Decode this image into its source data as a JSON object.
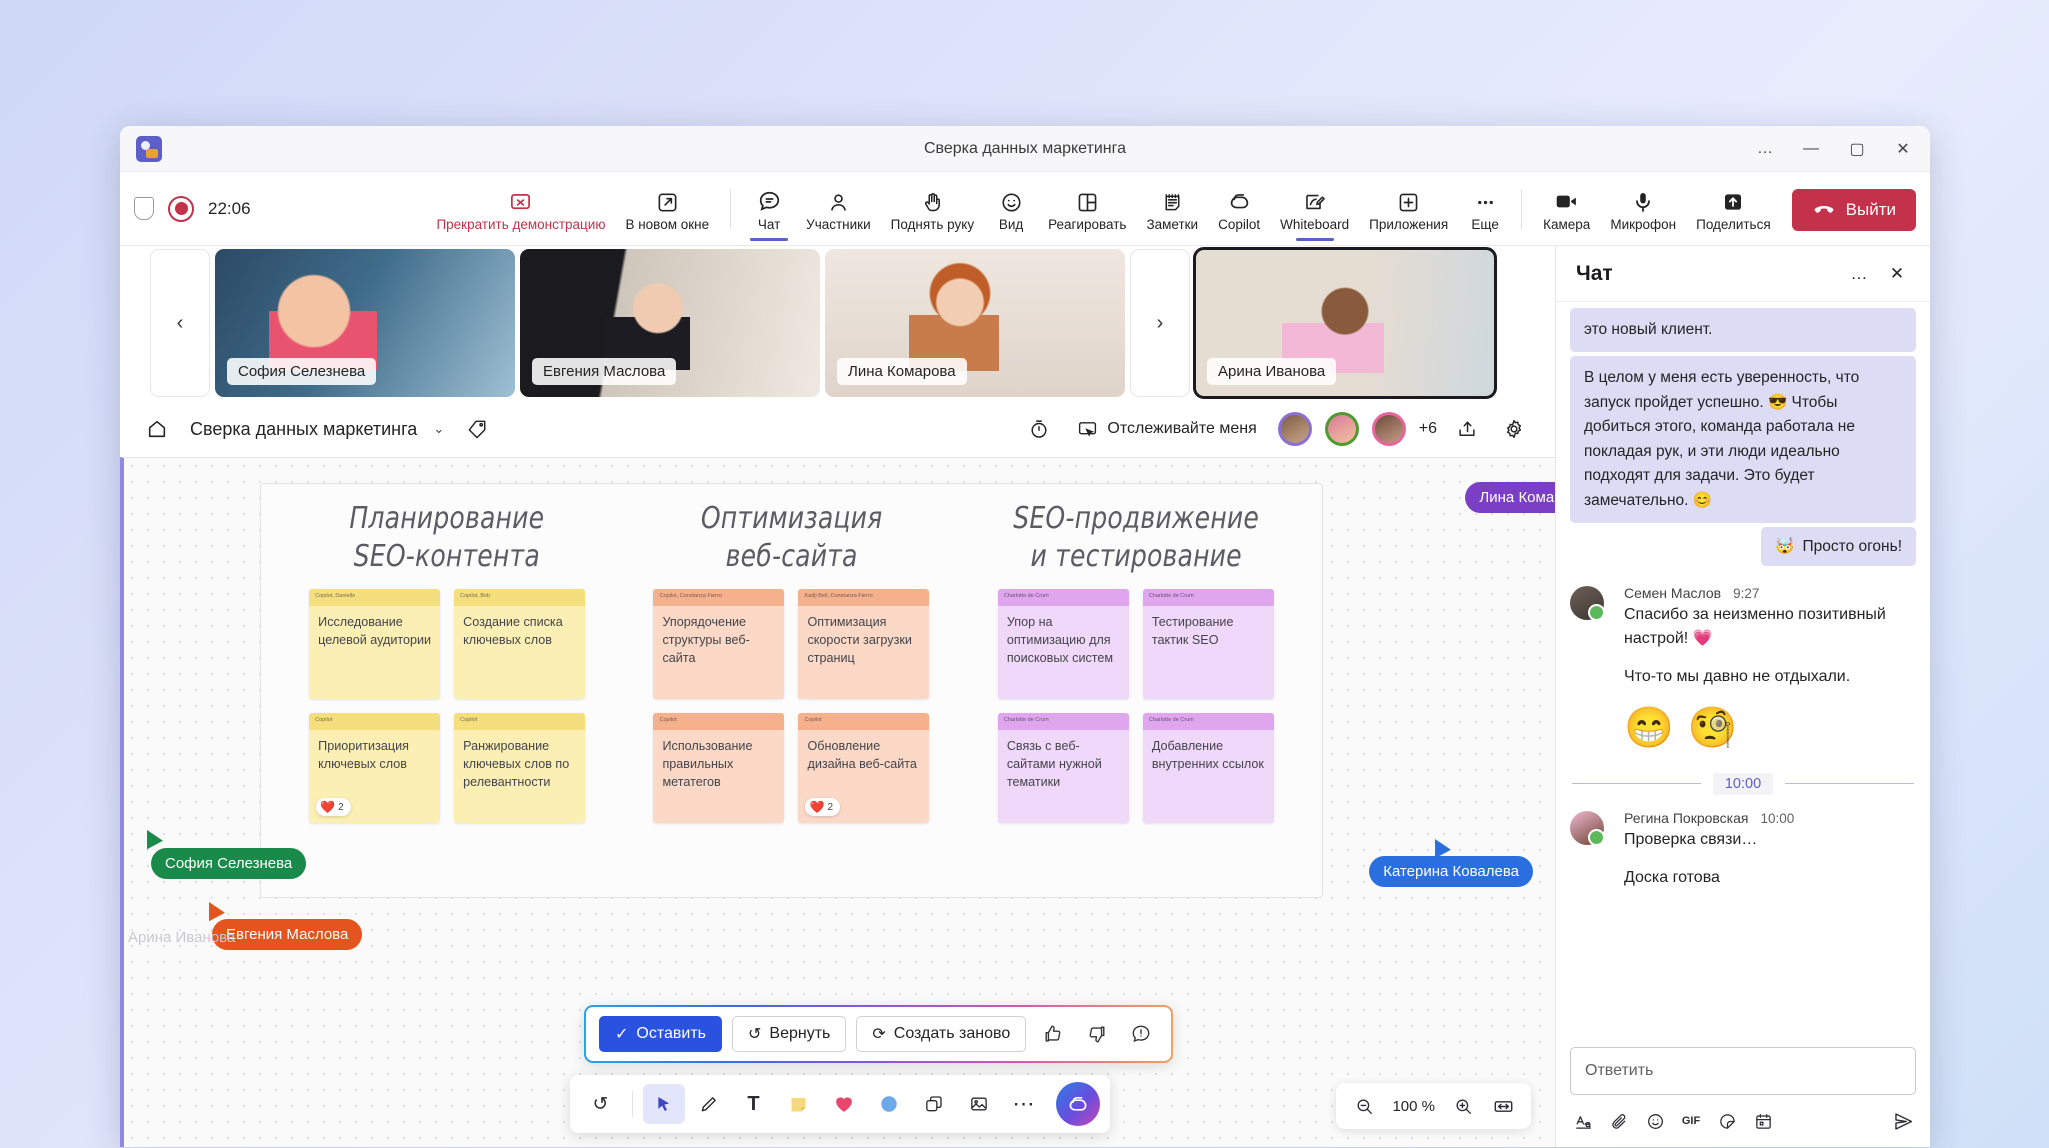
{
  "window": {
    "title": "Сверка данных маркетинга",
    "controls": {
      "more": "…",
      "minimize": "—",
      "maximize": "▢",
      "close": "✕"
    }
  },
  "meeting_bar": {
    "time": "22:06",
    "items": [
      {
        "label": "Прекратить демонстрацию",
        "icon": "stop-share-icon"
      },
      {
        "label": "В новом окне",
        "icon": "popout-icon"
      },
      {
        "label": "Чат",
        "icon": "chat-icon"
      },
      {
        "label": "Участники",
        "icon": "people-icon"
      },
      {
        "label": "Поднять руку",
        "icon": "raise-hand-icon"
      },
      {
        "label": "Вид",
        "icon": "view-icon"
      },
      {
        "label": "Реагировать",
        "icon": "react-icon"
      },
      {
        "label": "Заметки",
        "icon": "notes-icon"
      },
      {
        "label": "Copilot",
        "icon": "copilot-icon"
      },
      {
        "label": "Whiteboard",
        "icon": "whiteboard-icon"
      },
      {
        "label": "Приложения",
        "icon": "apps-icon"
      },
      {
        "label": "Еще",
        "icon": "more-icon"
      },
      {
        "label": "Камера",
        "icon": "camera-icon"
      },
      {
        "label": "Микрофон",
        "icon": "microphone-icon"
      },
      {
        "label": "Поделиться",
        "icon": "share-icon"
      }
    ],
    "leave_label": "Выйти"
  },
  "video_strip": {
    "prev": "‹",
    "next": "›",
    "participants": [
      {
        "name": "София Селезнева",
        "active": false
      },
      {
        "name": "Евгения Маслова",
        "active": false
      },
      {
        "name": "Лина Комарова",
        "active": false
      },
      {
        "name": "Арина Иванова",
        "active": true
      }
    ]
  },
  "whiteboard_header": {
    "title": "Сверка данных маркетинга",
    "chevron": "⌄",
    "follow_label": "Отслеживайте меня",
    "overflow_count": "+6"
  },
  "board": {
    "columns": [
      {
        "title_line1": "Планирование",
        "title_line2": "SEO-контента",
        "color": "y",
        "notes": [
          {
            "author": "Copilot, Danielle",
            "text": "Исследование целевой аудитории",
            "reaction": null
          },
          {
            "author": "Copilot, Bob",
            "text": "Создание списка ключевых слов",
            "reaction": null
          },
          {
            "author": "Copilot",
            "text": "Приоритизация ключевых слов",
            "reaction": {
              "emoji": "❤️",
              "count": "2"
            }
          },
          {
            "author": "Copilot",
            "text": "Ранжирование ключевых слов по релевантности",
            "reaction": null
          }
        ]
      },
      {
        "title_line1": "Оптимизация",
        "title_line2": "веб-сайта",
        "color": "o",
        "notes": [
          {
            "author": "Copilot, Constanza Fierro",
            "text": "Упорядочение структуры веб-сайта",
            "reaction": null
          },
          {
            "author": "Kadji Bell, Constanza Fierro",
            "text": "Оптимизация скорости загрузки страниц",
            "reaction": null
          },
          {
            "author": "Copilot",
            "text": "Использование правильных метатегов",
            "reaction": null
          },
          {
            "author": "Copilot",
            "text": "Обновление дизайна веб-сайта",
            "reaction": {
              "emoji": "❤️",
              "count": "2"
            }
          }
        ]
      },
      {
        "title_line1": "SEO-продвижение",
        "title_line2": "и тестирование",
        "color": "p",
        "notes": [
          {
            "author": "Charlotte de Crum",
            "text": "Упор на оптимизацию для поисковых систем",
            "reaction": null
          },
          {
            "author": "Charlotte de Crum",
            "text": "Тестирование тактик SEO",
            "reaction": null
          },
          {
            "author": "Charlotte de Crum",
            "text": "Связь с веб-сайтами нужной тематики",
            "reaction": null
          },
          {
            "author": "Charlotte de Crum",
            "text": "Добавление внутренних ссылок",
            "reaction": null
          }
        ]
      }
    ],
    "cursors": [
      {
        "name": "Лина Комарова",
        "color": "#7a3fc4"
      },
      {
        "name": "София Селезнева",
        "color": "#1a8a4a"
      },
      {
        "name": "Евгения Маслова",
        "color": "#e4541f"
      },
      {
        "name": "Катерина Ковалева",
        "color": "#2a6fe0"
      },
      {
        "name": "Арина Иванова",
        "color": "#c9c9cf"
      }
    ]
  },
  "copilot_bar": {
    "keep_label": "Оставить",
    "undo_label": "Вернуть",
    "regenerate_label": "Создать заново",
    "thumb_up": "thumbs-up-icon",
    "thumb_down": "thumbs-down-icon",
    "report": "report-icon"
  },
  "dock": {
    "tools": [
      {
        "name": "undo-tool",
        "glyph": "↺"
      },
      {
        "name": "select-tool",
        "glyph": "➤",
        "selected": true
      },
      {
        "name": "pen-tool",
        "glyph": "✎"
      },
      {
        "name": "text-tool",
        "glyph": "T"
      },
      {
        "name": "note-tool",
        "glyph": "▢"
      },
      {
        "name": "reaction-tool",
        "glyph": "♥"
      },
      {
        "name": "shape-tool",
        "glyph": "●"
      },
      {
        "name": "sticker-tool",
        "glyph": "⧉"
      },
      {
        "name": "image-tool",
        "glyph": "▣"
      },
      {
        "name": "more-tool",
        "glyph": "⋯"
      }
    ],
    "copilot": "copilot-button"
  },
  "zoom_bar": {
    "zoom_out": "zoom-out-icon",
    "level": "100 %",
    "zoom_in": "zoom-in-icon",
    "fit": "fit-to-screen-icon"
  },
  "chat": {
    "title": "Чат",
    "more": "…",
    "close": "✕",
    "messages": [
      {
        "type": "incoming-partial",
        "text": "это новый клиент."
      },
      {
        "type": "incoming",
        "text": "В целом у меня есть уверенность, что запуск пройдет успешно. 😎 Чтобы добиться этого, команда работала не покладая рук, и эти люди идеально подходят для задачи. Это будет замечательно. 😊"
      },
      {
        "type": "outgoing",
        "emoji": "🤯",
        "text": "Просто огонь!"
      },
      {
        "type": "card",
        "author": "Семен Маслов",
        "time": "9:27",
        "text": "Спасибо за неизменно позитивный настрой! 💗",
        "sub": "Что-то мы давно не отдыхали.",
        "big_emoji": [
          "😁",
          "🧐"
        ]
      },
      {
        "type": "time-divider",
        "label": "10:00"
      },
      {
        "type": "card",
        "author": "Регина Покровская",
        "time": "10:00",
        "text": "Проверка связи…",
        "sub": "Доска готова"
      }
    ],
    "compose": {
      "placeholder": "Ответить",
      "tools": [
        {
          "name": "format-icon",
          "glyph": "A̲"
        },
        {
          "name": "attach-icon",
          "glyph": "🖇"
        },
        {
          "name": "emoji-icon",
          "glyph": "☺"
        },
        {
          "name": "gif-icon",
          "glyph": "GIF"
        },
        {
          "name": "sticker-icon",
          "glyph": "▤"
        },
        {
          "name": "calendar-icon",
          "glyph": "▦"
        },
        {
          "name": "send-icon",
          "glyph": "➤"
        }
      ]
    }
  }
}
